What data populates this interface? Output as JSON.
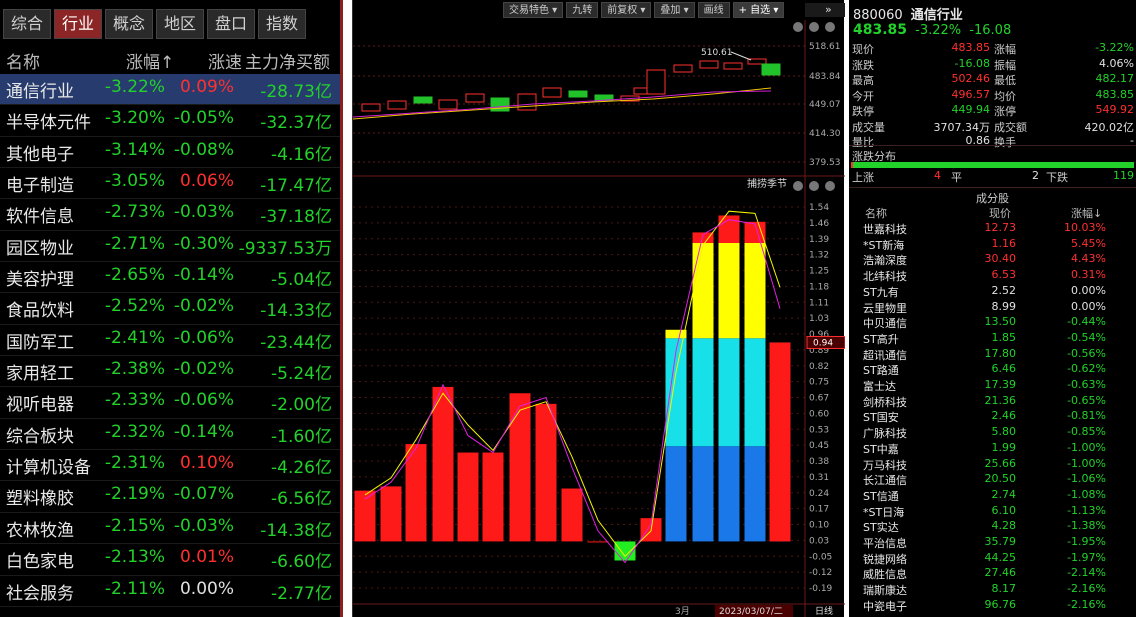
{
  "left_tabs": [
    "综合",
    "行业",
    "概念",
    "地区",
    "盘口",
    "指数"
  ],
  "left_headers": {
    "name": "名称",
    "change": "涨幅↑",
    "speed": "涨速",
    "netflow": "主力净买额"
  },
  "sectors": [
    {
      "name": "通信行业",
      "change": "-3.22%",
      "speed": "0.09%",
      "net": "-28.73亿"
    },
    {
      "name": "半导体元件",
      "change": "-3.20%",
      "speed": "-0.05%",
      "net": "-32.37亿"
    },
    {
      "name": "其他电子",
      "change": "-3.14%",
      "speed": "-0.08%",
      "net": "-4.16亿"
    },
    {
      "name": "电子制造",
      "change": "-3.05%",
      "speed": "0.06%",
      "net": "-17.47亿"
    },
    {
      "name": "软件信息",
      "change": "-2.73%",
      "speed": "-0.03%",
      "net": "-37.18亿"
    },
    {
      "name": "园区物业",
      "change": "-2.71%",
      "speed": "-0.30%",
      "net": "-9337.53万"
    },
    {
      "name": "美容护理",
      "change": "-2.65%",
      "speed": "-0.14%",
      "net": "-5.04亿"
    },
    {
      "name": "食品饮料",
      "change": "-2.52%",
      "speed": "-0.02%",
      "net": "-14.33亿"
    },
    {
      "name": "国防军工",
      "change": "-2.41%",
      "speed": "-0.06%",
      "net": "-23.44亿"
    },
    {
      "name": "家用轻工",
      "change": "-2.38%",
      "speed": "-0.02%",
      "net": "-5.24亿"
    },
    {
      "name": "视听电器",
      "change": "-2.33%",
      "speed": "-0.06%",
      "net": "-2.00亿"
    },
    {
      "name": "综合板块",
      "change": "-2.32%",
      "speed": "-0.14%",
      "net": "-1.60亿"
    },
    {
      "name": "计算机设备",
      "change": "-2.31%",
      "speed": "0.10%",
      "net": "-4.26亿"
    },
    {
      "name": "塑料橡胶",
      "change": "-2.19%",
      "speed": "-0.07%",
      "net": "-6.56亿"
    },
    {
      "name": "农林牧渔",
      "change": "-2.15%",
      "speed": "-0.03%",
      "net": "-14.38亿"
    },
    {
      "name": "白色家电",
      "change": "-2.13%",
      "speed": "0.01%",
      "net": "-6.60亿"
    },
    {
      "name": "社会服务",
      "change": "-2.11%",
      "speed": "0.00%",
      "net": "-2.77亿"
    }
  ],
  "toolbar": [
    "交易特色 ▾",
    "九转",
    "前复权 ▾",
    "叠加 ▾",
    "画线",
    "+ 自选 ▾"
  ],
  "chart": {
    "top_price_label": "510.61",
    "top_ticks": [
      "518.61",
      "483.84",
      "449.07",
      "414.30",
      "379.53"
    ],
    "indicator_name": "捕捞季节",
    "indicator_current": "0.94",
    "indicator_ticks": [
      "1.54",
      "1.46",
      "1.39",
      "1.32",
      "1.25",
      "1.18",
      "1.11",
      "1.03",
      "0.96",
      "0.89",
      "0.82",
      "0.75",
      "0.67",
      "0.60",
      "0.53",
      "0.45",
      "0.38",
      "0.31",
      "0.24",
      "0.17",
      "0.10",
      "0.03",
      "-0.05",
      "-0.12",
      "-0.19"
    ],
    "x_month": "3月",
    "x_date": "2023/03/07/二",
    "x_period": "日线"
  },
  "chart_data": {
    "type": "bar",
    "title": "捕捞季节",
    "values": [
      0.24,
      0.26,
      0.46,
      0.73,
      0.42,
      0.42,
      0.7,
      0.65,
      0.25,
      0.0,
      -0.09,
      0.11,
      1.0,
      1.46,
      1.54,
      1.51,
      0.94
    ],
    "ylim": [
      -0.22,
      1.58
    ]
  },
  "quote": {
    "code": "880060",
    "name": "通信行业",
    "price": "483.85",
    "change_pct": "-3.22%",
    "change": "-16.08",
    "rows": [
      {
        "l1": "现价",
        "v1": "483.85",
        "l2": "涨幅",
        "v2": "-3.22%",
        "c1": "red",
        "c2": "green"
      },
      {
        "l1": "涨跌",
        "v1": "-16.08",
        "l2": "振幅",
        "v2": "4.06%",
        "c1": "green",
        "c2": "white"
      },
      {
        "l1": "最高",
        "v1": "502.46",
        "l2": "最低",
        "v2": "482.17",
        "c1": "red",
        "c2": "green"
      },
      {
        "l1": "今开",
        "v1": "496.57",
        "l2": "均价",
        "v2": "483.85",
        "c1": "red",
        "c2": "green"
      },
      {
        "l1": "跌停",
        "v1": "449.94",
        "l2": "涨停",
        "v2": "549.92",
        "c1": "green",
        "c2": "red"
      },
      {
        "l1": "成交量",
        "v1": "3707.34万",
        "l2": "成交额",
        "v2": "420.02亿",
        "c1": "white",
        "c2": "white"
      },
      {
        "l1": "量比",
        "v1": "0.86",
        "l2": "换手",
        "v2": "-",
        "c1": "white",
        "c2": "white"
      }
    ],
    "dist_label": "涨跌分布",
    "up_label": "上涨",
    "up_count": "4",
    "flat_label": "平",
    "flat_count": "2",
    "down_label": "下跌",
    "down_count": "119"
  },
  "components_title": "成分股",
  "comp_headers": {
    "name": "名称",
    "price": "现价",
    "change": "涨幅↓"
  },
  "components": [
    {
      "name": "世嘉科技",
      "price": "12.73",
      "change": "10.03%",
      "c": "red"
    },
    {
      "name": "*ST新海",
      "price": "1.16",
      "change": "5.45%",
      "c": "red"
    },
    {
      "name": "浩瀚深度",
      "price": "30.40",
      "change": "4.43%",
      "c": "red"
    },
    {
      "name": "北纬科技",
      "price": "6.53",
      "change": "0.31%",
      "c": "red"
    },
    {
      "name": "ST九有",
      "price": "2.52",
      "change": "0.00%",
      "c": "white"
    },
    {
      "name": "云里物里",
      "price": "8.99",
      "change": "0.00%",
      "c": "white"
    },
    {
      "name": "中贝通信",
      "price": "13.50",
      "change": "-0.44%",
      "c": "green"
    },
    {
      "name": "ST高升",
      "price": "1.85",
      "change": "-0.54%",
      "c": "green"
    },
    {
      "name": "超讯通信",
      "price": "17.80",
      "change": "-0.56%",
      "c": "green"
    },
    {
      "name": "ST路通",
      "price": "6.46",
      "change": "-0.62%",
      "c": "green"
    },
    {
      "name": "富士达",
      "price": "17.39",
      "change": "-0.63%",
      "c": "green"
    },
    {
      "name": "剑桥科技",
      "price": "21.36",
      "change": "-0.65%",
      "c": "green"
    },
    {
      "name": "ST国安",
      "price": "2.46",
      "change": "-0.81%",
      "c": "green"
    },
    {
      "name": "广脉科技",
      "price": "5.80",
      "change": "-0.85%",
      "c": "green"
    },
    {
      "name": "ST中嘉",
      "price": "1.99",
      "change": "-1.00%",
      "c": "green"
    },
    {
      "name": "万马科技",
      "price": "25.66",
      "change": "-1.00%",
      "c": "green"
    },
    {
      "name": "长江通信",
      "price": "20.50",
      "change": "-1.06%",
      "c": "green"
    },
    {
      "name": "ST信通",
      "price": "2.74",
      "change": "-1.08%",
      "c": "green"
    },
    {
      "name": "*ST日海",
      "price": "6.10",
      "change": "-1.13%",
      "c": "green"
    },
    {
      "name": "ST实达",
      "price": "4.28",
      "change": "-1.38%",
      "c": "green"
    },
    {
      "name": "平治信息",
      "price": "35.79",
      "change": "-1.95%",
      "c": "green"
    },
    {
      "name": "锐捷网络",
      "price": "44.25",
      "change": "-1.97%",
      "c": "green"
    },
    {
      "name": "威胜信息",
      "price": "27.46",
      "change": "-2.14%",
      "c": "green"
    },
    {
      "name": "瑞斯康达",
      "price": "8.17",
      "change": "-2.16%",
      "c": "green"
    },
    {
      "name": "中瓷电子",
      "price": "96.76",
      "change": "-2.16%",
      "c": "green"
    }
  ]
}
